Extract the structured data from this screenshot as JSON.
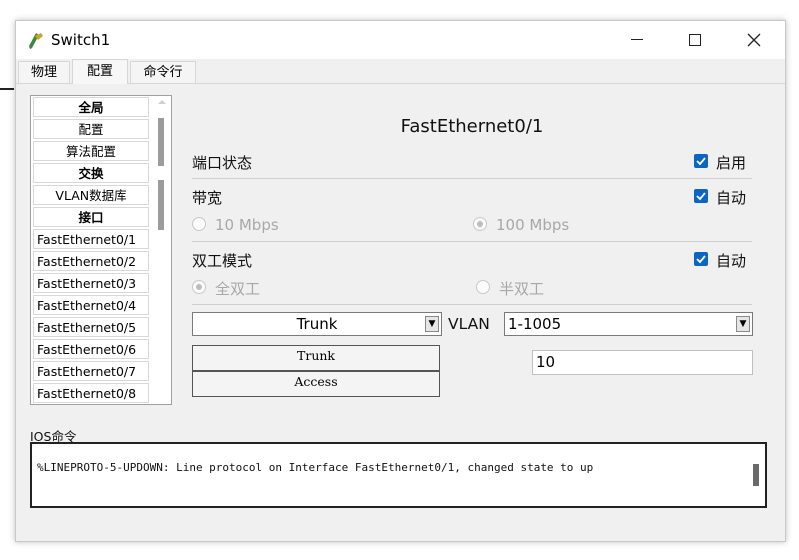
{
  "window": {
    "title": "Switch1"
  },
  "tabs": [
    {
      "label": "物理",
      "active": false
    },
    {
      "label": "配置",
      "active": true
    },
    {
      "label": "命令行",
      "active": false
    }
  ],
  "sidebar": {
    "items": [
      {
        "label": "全局",
        "style": "bold"
      },
      {
        "label": "配置",
        "style": "normal"
      },
      {
        "label": "算法配置",
        "style": "normal"
      },
      {
        "label": "交换",
        "style": "bold"
      },
      {
        "label": "VLAN数据库",
        "style": "normal"
      },
      {
        "label": "接口",
        "style": "bold"
      },
      {
        "label": "FastEthernet0/1",
        "style": "left"
      },
      {
        "label": "FastEthernet0/2",
        "style": "left"
      },
      {
        "label": "FastEthernet0/3",
        "style": "left"
      },
      {
        "label": "FastEthernet0/4",
        "style": "left"
      },
      {
        "label": "FastEthernet0/5",
        "style": "left"
      },
      {
        "label": "FastEthernet0/6",
        "style": "left"
      },
      {
        "label": "FastEthernet0/7",
        "style": "left"
      },
      {
        "label": "FastEthernet0/8",
        "style": "left"
      }
    ]
  },
  "panel": {
    "title": "FastEthernet0/1",
    "port_status": {
      "label": "端口状态",
      "checkbox_label": "启用",
      "checked": true
    },
    "bandwidth": {
      "label": "带宽",
      "auto_label": "自动",
      "auto_checked": true,
      "options": [
        {
          "label": "10 Mbps",
          "selected": false
        },
        {
          "label": "100 Mbps",
          "selected": true
        }
      ]
    },
    "duplex": {
      "label": "双工模式",
      "auto_label": "自动",
      "auto_checked": true,
      "options": [
        {
          "label": "全双工",
          "selected": true
        },
        {
          "label": "半双工",
          "selected": false
        }
      ]
    },
    "mode_select": {
      "value": "Trunk",
      "options": [
        "Trunk",
        "Access"
      ]
    },
    "vlan": {
      "label": "VLAN",
      "select_value": "1-1005",
      "text_value": "10"
    }
  },
  "ios": {
    "label": "IOS命令",
    "text": "%LINEPROTO-5-UPDOWN: Line protocol on Interface FastEthernet0/1, changed state to up"
  },
  "colors": {
    "checkbox_accent": "#0a66c2",
    "disabled_text": "#a8a8a8"
  }
}
